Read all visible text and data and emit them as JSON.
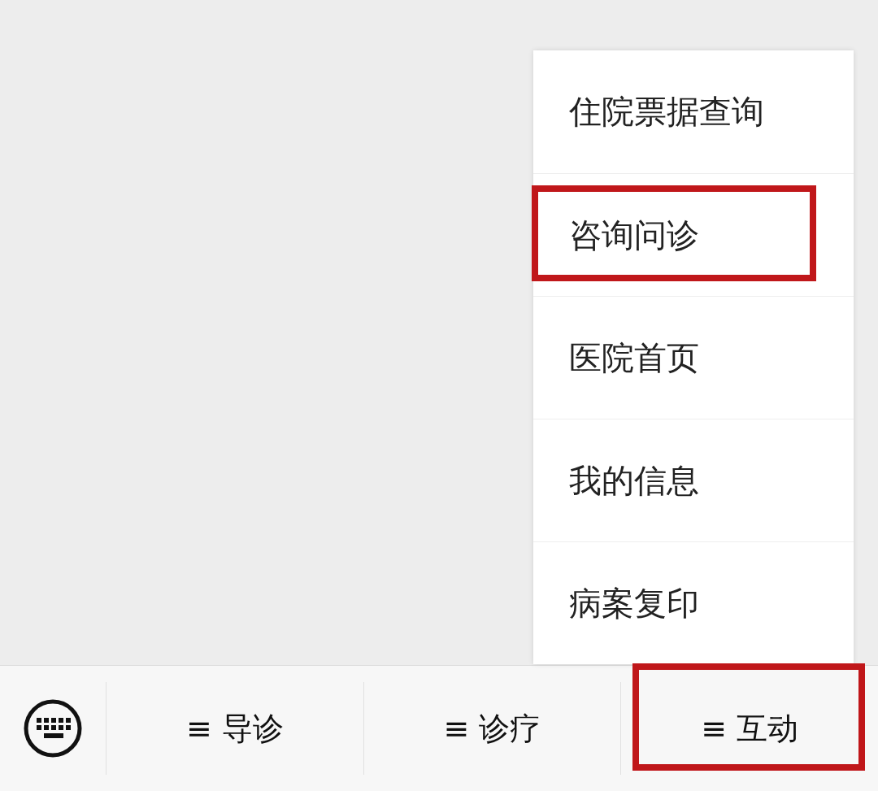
{
  "popup_menu": {
    "items": [
      {
        "label": "住院票据查询",
        "highlighted": false
      },
      {
        "label": "咨询问诊",
        "highlighted": true
      },
      {
        "label": "医院首页",
        "highlighted": false
      },
      {
        "label": "我的信息",
        "highlighted": false
      },
      {
        "label": "病案复印",
        "highlighted": false
      }
    ]
  },
  "bottom_bar": {
    "menus": [
      {
        "icon": "≡",
        "label": "导诊",
        "highlighted": false
      },
      {
        "icon": "≡",
        "label": "诊疗",
        "highlighted": false
      },
      {
        "icon": "≡",
        "label": "互动",
        "highlighted": true
      }
    ]
  }
}
